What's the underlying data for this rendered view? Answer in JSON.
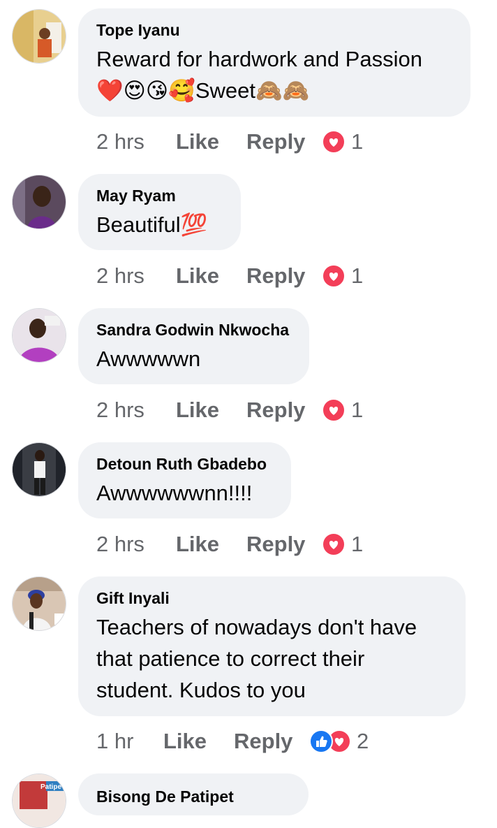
{
  "comments": [
    {
      "author": "Tope Iyanu",
      "text_line1": "Reward for hardwork and Passion",
      "text_line2": "❤️😍😘🥰Sweet🙈🙈",
      "time": "2 hrs",
      "like": "Like",
      "reply": "Reply",
      "reaction_count": "1",
      "reactions": [
        "love-icon"
      ]
    },
    {
      "author": "May Ryam",
      "text": "Beautiful💯",
      "time": "2 hrs",
      "like": "Like",
      "reply": "Reply",
      "reaction_count": "1",
      "reactions": [
        "love-icon"
      ]
    },
    {
      "author": "Sandra Godwin Nkwocha",
      "text": "Awwwwwn",
      "time": "2 hrs",
      "like": "Like",
      "reply": "Reply",
      "reaction_count": "1",
      "reactions": [
        "love-icon"
      ]
    },
    {
      "author": "Detoun Ruth Gbadebo",
      "text": "Awwwwwwnn!!!!",
      "time": "2 hrs",
      "like": "Like",
      "reply": "Reply",
      "reaction_count": "1",
      "reactions": [
        "love-icon"
      ]
    },
    {
      "author": "Gift Inyali",
      "text_line1": "Teachers of nowadays don't have",
      "text_line2": "that patience  to correct their",
      "text_line3": "student. Kudos to you",
      "time": "1 hr",
      "like": "Like",
      "reply": "Reply",
      "reaction_count": "2",
      "reactions": [
        "like-icon",
        "love-icon"
      ]
    },
    {
      "author": "Bisong De Patipet",
      "avatar_badge": "Patipe"
    }
  ],
  "colors": {
    "bubble": "#f0f2f5",
    "muted_text": "#65676b",
    "love": "#f33e58",
    "like": "#1877f2"
  }
}
